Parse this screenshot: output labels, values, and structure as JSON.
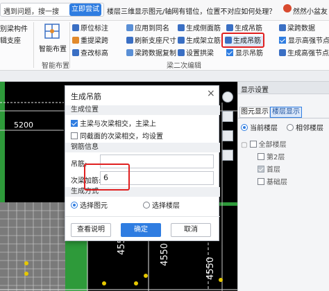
{
  "topbar": {
    "search_placeholder": "遇到问题，搜一搜",
    "ask_button": "立即尝试",
    "banner_text": "楼层三维显示图元/轴网有错位，位置不对应如何处理？",
    "user_name": "然然小盆友"
  },
  "ribbon": {
    "left_cut_1": "别梁构件",
    "left_cut_2": "辑支座",
    "smart_layout": "智能布置",
    "smart_layout_group": "智能布置",
    "row1": [
      "原位标注",
      "应用到同名",
      "生成侧面筋",
      "生成吊筋",
      "梁跨数据"
    ],
    "row2": [
      "重提梁跨",
      "刷新支座尺寸",
      "生成架立筋",
      "生成吊筋",
      "显示高强节点"
    ],
    "row3": [
      "查改标高",
      "梁跨数据复制",
      "设置拱梁",
      "显示吊筋",
      "生成高强节点"
    ],
    "group_label": "梁二次编辑"
  },
  "canvas": {
    "dim_5200": "5200",
    "dim_4550_a": "4550",
    "dim_4550_b": "4550",
    "dim_4550_c": "4550"
  },
  "right_panel": {
    "title": "显示设置",
    "tab_element": "图元显示",
    "tab_floor": "楼层显示",
    "radio_current": "当前楼层",
    "radio_adjacent": "相邻楼层",
    "tree_all": "全部楼层",
    "tree_floor2": "第2层",
    "tree_first": "首层",
    "tree_base": "基础层"
  },
  "dialog": {
    "title": "生成吊筋",
    "section_position": "生成位置",
    "opt_main_secondary": "主梁与次梁相交，主梁上",
    "opt_same_section": "同截面的次梁相交，均设置",
    "section_rebar": "钢筋信息",
    "label_hanging": "吊筋:",
    "value_hanging": "",
    "label_extra_stirrup": "次梁加筋:",
    "value_extra_stirrup": "6",
    "section_method": "生成方式",
    "radio_select_element": "选择图元",
    "radio_select_floor": "选择楼层",
    "btn_help": "查看说明",
    "btn_ok": "确定",
    "btn_cancel": "取消"
  }
}
